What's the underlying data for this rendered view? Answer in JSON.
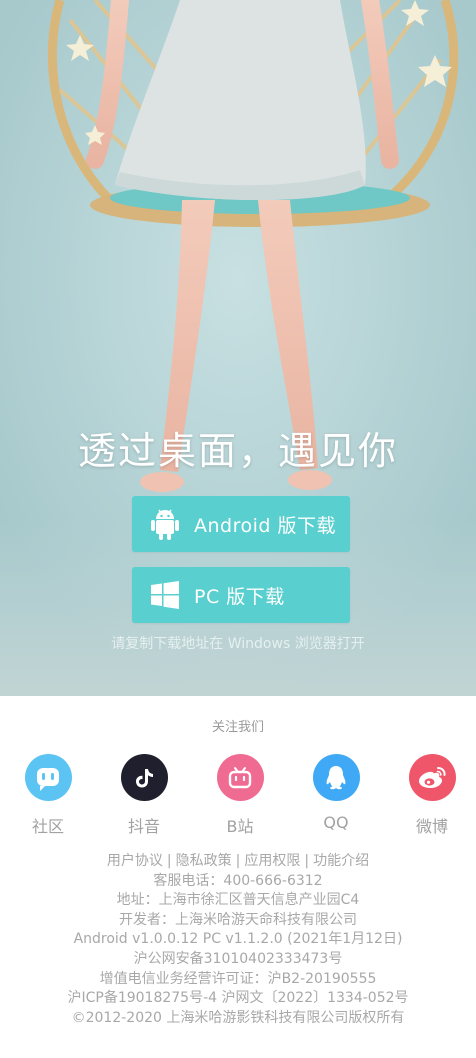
{
  "hero": {
    "tagline": "透过桌面，遇见你",
    "android_button": {
      "label": "Android 版下载",
      "icon": "android-icon"
    },
    "pc_button": {
      "label": "PC 版下载",
      "icon": "windows-icon"
    },
    "hint": "请复制下载地址在 Windows 浏览器打开"
  },
  "footer": {
    "follow_title": "关注我们",
    "socials": [
      {
        "name": "社区",
        "icon": "community-icon",
        "color": "#5bc4f2"
      },
      {
        "name": "抖音",
        "icon": "douyin-icon",
        "color": "#1f1f2e"
      },
      {
        "name": "B站",
        "icon": "bilibili-icon",
        "color": "#f06b92"
      },
      {
        "name": "QQ",
        "icon": "qq-icon",
        "color": "#3fa9f5"
      },
      {
        "name": "微博",
        "icon": "weibo-icon",
        "color": "#f0566a"
      }
    ],
    "links": [
      "用户协议",
      "隐私政策",
      "应用权限",
      "功能介绍"
    ],
    "separator": "|",
    "service_phone": "客服电话：400-666-6312",
    "address": "地址：上海市徐汇区普天信息产业园C4",
    "developer": "开发者：上海米哈游天命科技有限公司",
    "version": "Android v1.0.0.12 PC v1.1.2.0 (2021年1月12日)",
    "police_record": "沪公网安备31010402333473号",
    "telecom_license": "增值电信业务经营许可证：沪B2-20190555",
    "icp": "沪ICP备19018275号-4 沪网文〔2022〕1334-052号",
    "copyright": "©2012-2020 上海米哈游影铁科技有限公司版权所有"
  }
}
